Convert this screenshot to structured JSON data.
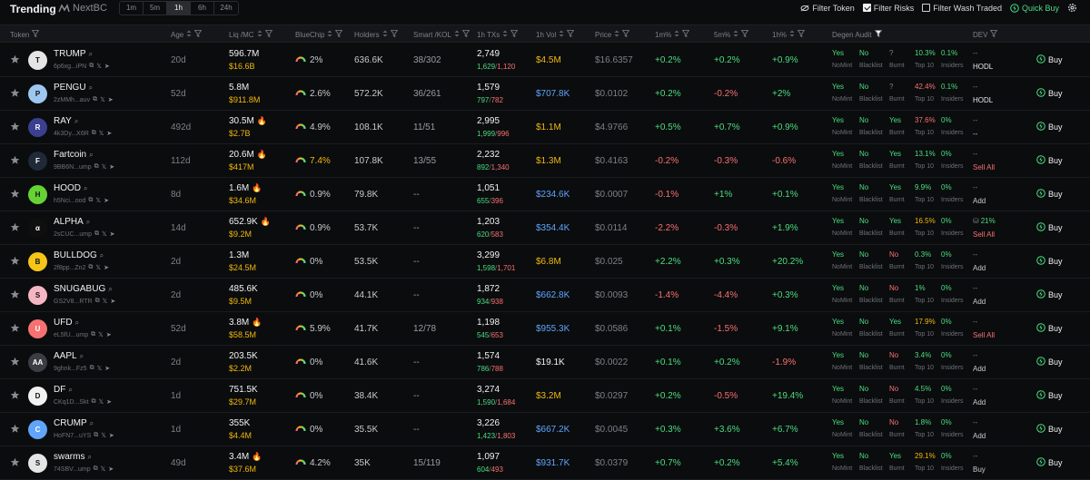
{
  "header": {
    "title": "Trending",
    "brand": "NextBC",
    "timeframes": [
      "1m",
      "5m",
      "1h",
      "6h",
      "24h"
    ],
    "active_timeframe": "1h",
    "filters": [
      {
        "label": "Filter Token",
        "icon": "eye-slash-icon"
      },
      {
        "label": "Filter Risks",
        "checked": true
      },
      {
        "label": "Filter Wash Traded",
        "checked": false
      }
    ],
    "quick_buy": "Quick Buy"
  },
  "columns": [
    "Token",
    "Age",
    "Liq /MC",
    "BlueChip",
    "Holders",
    "Smart /KOL",
    "1h TXs",
    "1h Vol",
    "Price",
    "1m%",
    "5m%",
    "1h%",
    "Degen Audit",
    "DEV"
  ],
  "colors": {
    "green": "#4ade80",
    "red": "#f87171",
    "gold": "#f0b90b",
    "blue": "#60a5fa"
  },
  "audit_labels": [
    "NoMint",
    "Blacklist",
    "Burnt",
    "Top 10",
    "Insiders"
  ],
  "buy_label": "Buy",
  "rows": [
    {
      "sym": "TRUMP",
      "addr": "6p6xg...iPN",
      "logo": "T",
      "logo_bg": "#e5e5e5",
      "age": "20d",
      "liq": "596.7M",
      "fire": false,
      "mc": "$16.6B",
      "bluechip": "2%",
      "holders": "636.6K",
      "smart": "38/302",
      "tx": "2,749",
      "tx_buy": "1,629",
      "tx_sell": "1,120",
      "vol": "$4.5M",
      "vol_color": "gold",
      "price": "$16.6357",
      "m1": "+0.2%",
      "m5": "+0.2%",
      "h1": "+0.9%",
      "a_nomint": "Yes",
      "a_black": "No",
      "a_burnt": "?",
      "a_top": "10.3%",
      "a_ins": "0.1%",
      "dev1": "--",
      "dev2": "HODL"
    },
    {
      "sym": "PENGU",
      "addr": "2zMMh...auv",
      "logo": "P",
      "logo_bg": "#9ec7f0",
      "age": "52d",
      "liq": "5.8M",
      "fire": false,
      "mc": "$911.8M",
      "bluechip": "2.6%",
      "holders": "572.2K",
      "smart": "36/261",
      "tx": "1,579",
      "tx_buy": "797",
      "tx_sell": "782",
      "vol": "$707.8K",
      "vol_color": "blue",
      "price": "$0.0102",
      "m1": "+0.2%",
      "m5": "-0.2%",
      "h1": "+2%",
      "a_nomint": "Yes",
      "a_black": "No",
      "a_burnt": "?",
      "a_top": "42.4%",
      "a_ins": "0.1%",
      "dev1": "--",
      "dev2": "HODL"
    },
    {
      "sym": "RAY",
      "addr": "4k3Dy...X6R",
      "logo": "R",
      "logo_bg": "#3b3f8f",
      "age": "492d",
      "liq": "30.5M",
      "fire": true,
      "mc": "$2.7B",
      "bluechip": "4.9%",
      "holders": "108.1K",
      "smart": "11/51",
      "tx": "2,995",
      "tx_buy": "1,999",
      "tx_sell": "996",
      "vol": "$1.1M",
      "vol_color": "gold",
      "price": "$4.9766",
      "m1": "+0.5%",
      "m5": "+0.7%",
      "h1": "+0.9%",
      "a_nomint": "Yes",
      "a_black": "No",
      "a_burnt": "Yes",
      "a_top": "37.6%",
      "a_ins": "0%",
      "dev1": "--",
      "dev2": "--"
    },
    {
      "sym": "Fartcoin",
      "addr": "9BB6N...ump",
      "logo": "F",
      "logo_bg": "#1f2937",
      "age": "112d",
      "liq": "20.6M",
      "fire": true,
      "mc": "$417M",
      "bluechip": "7.4%",
      "holders": "107.8K",
      "smart": "13/55",
      "tx": "2,232",
      "tx_buy": "892",
      "tx_sell": "1,340",
      "vol": "$1.3M",
      "vol_color": "gold",
      "price": "$0.4163",
      "m1": "-0.2%",
      "m5": "-0.3%",
      "h1": "-0.6%",
      "a_nomint": "Yes",
      "a_black": "No",
      "a_burnt": "Yes",
      "a_top": "13.1%",
      "a_ins": "0%",
      "dev1": "--",
      "dev2": "Sell All"
    },
    {
      "sym": "HOOD",
      "addr": "h5Nci...ood",
      "logo": "H",
      "logo_bg": "#65d334",
      "age": "8d",
      "liq": "1.6M",
      "fire": true,
      "mc": "$34.6M",
      "bluechip": "0.9%",
      "holders": "79.8K",
      "smart": "--",
      "tx": "1,051",
      "tx_buy": "655",
      "tx_sell": "396",
      "vol": "$234.6K",
      "vol_color": "blue",
      "price": "$0.0007",
      "m1": "-0.1%",
      "m5": "+1%",
      "h1": "+0.1%",
      "a_nomint": "Yes",
      "a_black": "No",
      "a_burnt": "Yes",
      "a_top": "9.9%",
      "a_ins": "0%",
      "dev1": "--",
      "dev2": "Add"
    },
    {
      "sym": "ALPHA",
      "addr": "2sCUC...ump",
      "logo": "α",
      "logo_bg": "#0f0f0f",
      "age": "14d",
      "liq": "652.9K",
      "fire": true,
      "mc": "$9.2M",
      "bluechip": "0.9%",
      "holders": "53.7K",
      "smart": "--",
      "tx": "1,203",
      "tx_buy": "620",
      "tx_sell": "583",
      "vol": "$354.4K",
      "vol_color": "blue",
      "price": "$0.0114",
      "m1": "-2.2%",
      "m5": "-0.3%",
      "h1": "+1.9%",
      "a_nomint": "Yes",
      "a_black": "No",
      "a_burnt": "Yes",
      "a_top": "16.5%",
      "a_ins": "0%",
      "dev1": "21%",
      "dev2": "Sell All"
    },
    {
      "sym": "BULLDOG",
      "addr": "2f8pp...Zn2",
      "logo": "B",
      "logo_bg": "#f5c518",
      "age": "2d",
      "liq": "1.3M",
      "fire": false,
      "mc": "$24.5M",
      "bluechip": "0%",
      "holders": "53.5K",
      "smart": "--",
      "tx": "3,299",
      "tx_buy": "1,598",
      "tx_sell": "1,701",
      "vol": "$6.8M",
      "vol_color": "gold",
      "price": "$0.025",
      "m1": "+2.2%",
      "m5": "+0.3%",
      "h1": "+20.2%",
      "a_nomint": "Yes",
      "a_black": "No",
      "a_burnt": "No",
      "a_top": "0.3%",
      "a_ins": "0%",
      "dev1": "--",
      "dev2": "Add"
    },
    {
      "sym": "SNUGABUG",
      "addr": "GS2V8...RTR",
      "logo": "S",
      "logo_bg": "#f4b6c2",
      "age": "2d",
      "liq": "485.6K",
      "fire": false,
      "mc": "$9.5M",
      "bluechip": "0%",
      "holders": "44.1K",
      "smart": "--",
      "tx": "1,872",
      "tx_buy": "934",
      "tx_sell": "938",
      "vol": "$662.8K",
      "vol_color": "blue",
      "price": "$0.0093",
      "m1": "-1.4%",
      "m5": "-4.4%",
      "h1": "+0.3%",
      "a_nomint": "Yes",
      "a_black": "No",
      "a_burnt": "No",
      "a_top": "1%",
      "a_ins": "0%",
      "dev1": "--",
      "dev2": "Add"
    },
    {
      "sym": "UFD",
      "addr": "eL5fU...ump",
      "logo": "U",
      "logo_bg": "#f87171",
      "age": "52d",
      "liq": "3.8M",
      "fire": true,
      "mc": "$58.5M",
      "bluechip": "5.9%",
      "holders": "41.7K",
      "smart": "12/78",
      "tx": "1,198",
      "tx_buy": "545",
      "tx_sell": "653",
      "vol": "$955.3K",
      "vol_color": "blue",
      "price": "$0.0586",
      "m1": "+0.1%",
      "m5": "-1.5%",
      "h1": "+9.1%",
      "a_nomint": "Yes",
      "a_black": "No",
      "a_burnt": "Yes",
      "a_top": "17.9%",
      "a_ins": "0%",
      "dev1": "--",
      "dev2": "Sell All"
    },
    {
      "sym": "AAPL",
      "addr": "9ghnk...Fz5",
      "logo": "AA",
      "logo_bg": "#3a3d44",
      "age": "2d",
      "liq": "203.5K",
      "fire": false,
      "mc": "$2.2M",
      "bluechip": "0%",
      "holders": "41.6K",
      "smart": "--",
      "tx": "1,574",
      "tx_buy": "786",
      "tx_sell": "788",
      "vol": "$19.1K",
      "vol_color": "white",
      "price": "$0.0022",
      "m1": "+0.1%",
      "m5": "+0.2%",
      "h1": "-1.9%",
      "a_nomint": "Yes",
      "a_black": "No",
      "a_burnt": "No",
      "a_top": "3.4%",
      "a_ins": "0%",
      "dev1": "--",
      "dev2": "Add"
    },
    {
      "sym": "DF",
      "addr": "CKq1D...Skt",
      "logo": "D",
      "logo_bg": "#f2f2f2",
      "age": "1d",
      "liq": "751.5K",
      "fire": false,
      "mc": "$29.7M",
      "bluechip": "0%",
      "holders": "38.4K",
      "smart": "--",
      "tx": "3,274",
      "tx_buy": "1,590",
      "tx_sell": "1,684",
      "vol": "$3.2M",
      "vol_color": "gold",
      "price": "$0.0297",
      "m1": "+0.2%",
      "m5": "-0.5%",
      "h1": "+19.4%",
      "a_nomint": "Yes",
      "a_black": "No",
      "a_burnt": "No",
      "a_top": "4.5%",
      "a_ins": "0%",
      "dev1": "--",
      "dev2": "Add"
    },
    {
      "sym": "CRUMP",
      "addr": "HoFN7...uYS",
      "logo": "C",
      "logo_bg": "#60a5fa",
      "age": "1d",
      "liq": "355K",
      "fire": false,
      "mc": "$4.4M",
      "bluechip": "0%",
      "holders": "35.5K",
      "smart": "--",
      "tx": "3,226",
      "tx_buy": "1,423",
      "tx_sell": "1,803",
      "vol": "$667.2K",
      "vol_color": "blue",
      "price": "$0.0045",
      "m1": "+0.3%",
      "m5": "+3.6%",
      "h1": "+6.7%",
      "a_nomint": "Yes",
      "a_black": "No",
      "a_burnt": "No",
      "a_top": "1.8%",
      "a_ins": "0%",
      "dev1": "--",
      "dev2": "Add"
    },
    {
      "sym": "swarms",
      "addr": "74SBV...ump",
      "logo": "S",
      "logo_bg": "#e5e5e5",
      "age": "49d",
      "liq": "3.4M",
      "fire": true,
      "mc": "$37.6M",
      "bluechip": "4.2%",
      "holders": "35K",
      "smart": "15/119",
      "tx": "1,097",
      "tx_buy": "604",
      "tx_sell": "493",
      "vol": "$931.7K",
      "vol_color": "blue",
      "price": "$0.0379",
      "m1": "+0.7%",
      "m5": "+0.2%",
      "h1": "+5.4%",
      "a_nomint": "Yes",
      "a_black": "No",
      "a_burnt": "Yes",
      "a_top": "29.1%",
      "a_ins": "0%",
      "dev1": "--",
      "dev2": "Buy"
    }
  ]
}
